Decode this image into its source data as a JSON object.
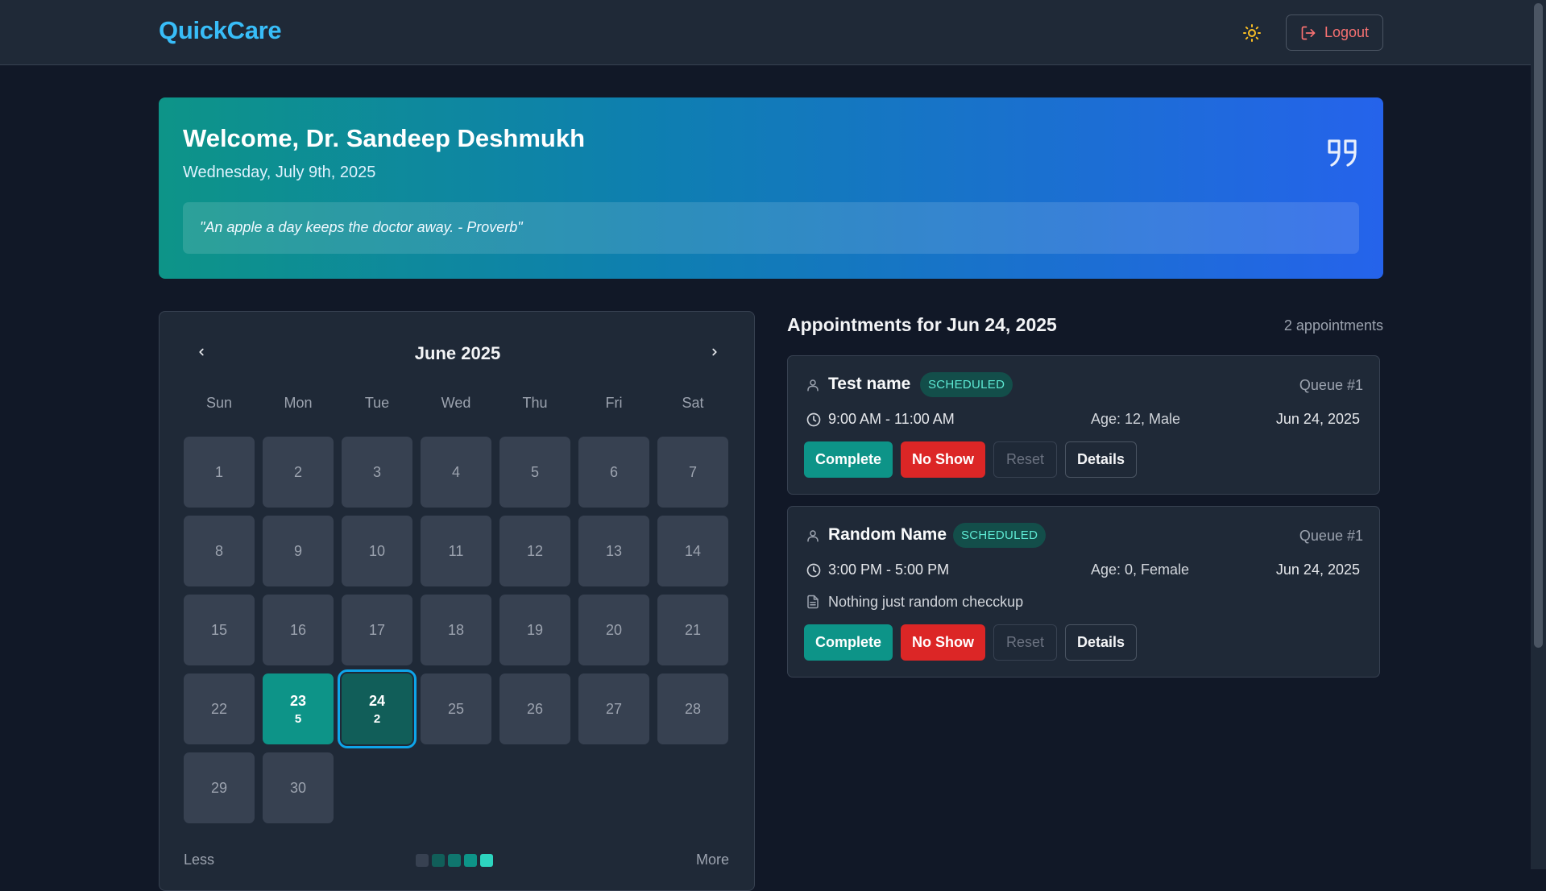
{
  "header": {
    "brand": "QuickCare",
    "logout_label": "Logout",
    "theme_icon": "sun-icon",
    "logout_icon": "logout-icon"
  },
  "welcome": {
    "title": "Welcome, Dr. Sandeep Deshmukh",
    "date": "Wednesday, July 9th, 2025",
    "quote": "\"An apple a day keeps the doctor away. - Proverb\"",
    "quote_icon": "quote-icon"
  },
  "calendar": {
    "month_label": "June 2025",
    "weekdays": [
      "Sun",
      "Mon",
      "Tue",
      "Wed",
      "Thu",
      "Fri",
      "Sat"
    ],
    "days": [
      {
        "day": "1"
      },
      {
        "day": "2"
      },
      {
        "day": "3"
      },
      {
        "day": "4"
      },
      {
        "day": "5"
      },
      {
        "day": "6"
      },
      {
        "day": "7"
      },
      {
        "day": "8"
      },
      {
        "day": "9"
      },
      {
        "day": "10"
      },
      {
        "day": "11"
      },
      {
        "day": "12"
      },
      {
        "day": "13"
      },
      {
        "day": "14"
      },
      {
        "day": "15"
      },
      {
        "day": "16"
      },
      {
        "day": "17"
      },
      {
        "day": "18"
      },
      {
        "day": "19"
      },
      {
        "day": "20"
      },
      {
        "day": "21"
      },
      {
        "day": "22"
      },
      {
        "day": "23",
        "count": "5",
        "state": "has5"
      },
      {
        "day": "24",
        "count": "2",
        "state": "sel"
      },
      {
        "day": "25"
      },
      {
        "day": "26"
      },
      {
        "day": "27"
      },
      {
        "day": "28"
      },
      {
        "day": "29"
      },
      {
        "day": "30"
      }
    ],
    "legend_less": "Less",
    "legend_more": "More",
    "legend_colors": [
      "#374151",
      "#115e59",
      "#0f766e",
      "#0d9488",
      "#2dd4bf"
    ]
  },
  "appointments": {
    "title": "Appointments for Jun 24, 2025",
    "count_label": "2 appointments",
    "items": [
      {
        "name": "Test name",
        "status": "SCHEDULED",
        "queue": "Queue #1",
        "time": "9:00 AM - 11:00 AM",
        "age": "Age: 12, Male",
        "date": "Jun 24, 2025",
        "note": ""
      },
      {
        "name": "Random Name",
        "status": "SCHEDULED",
        "queue": "Queue #1",
        "time": "3:00 PM - 5:00 PM",
        "age": "Age: 0, Female",
        "date": "Jun 24, 2025",
        "note": "Nothing just random checckup"
      }
    ],
    "actions": {
      "complete": "Complete",
      "no_show": "No Show",
      "reset": "Reset",
      "details": "Details"
    }
  },
  "colors": {
    "accent": "#0d9488",
    "brand": "#38bdf8",
    "danger": "#dc2626"
  }
}
